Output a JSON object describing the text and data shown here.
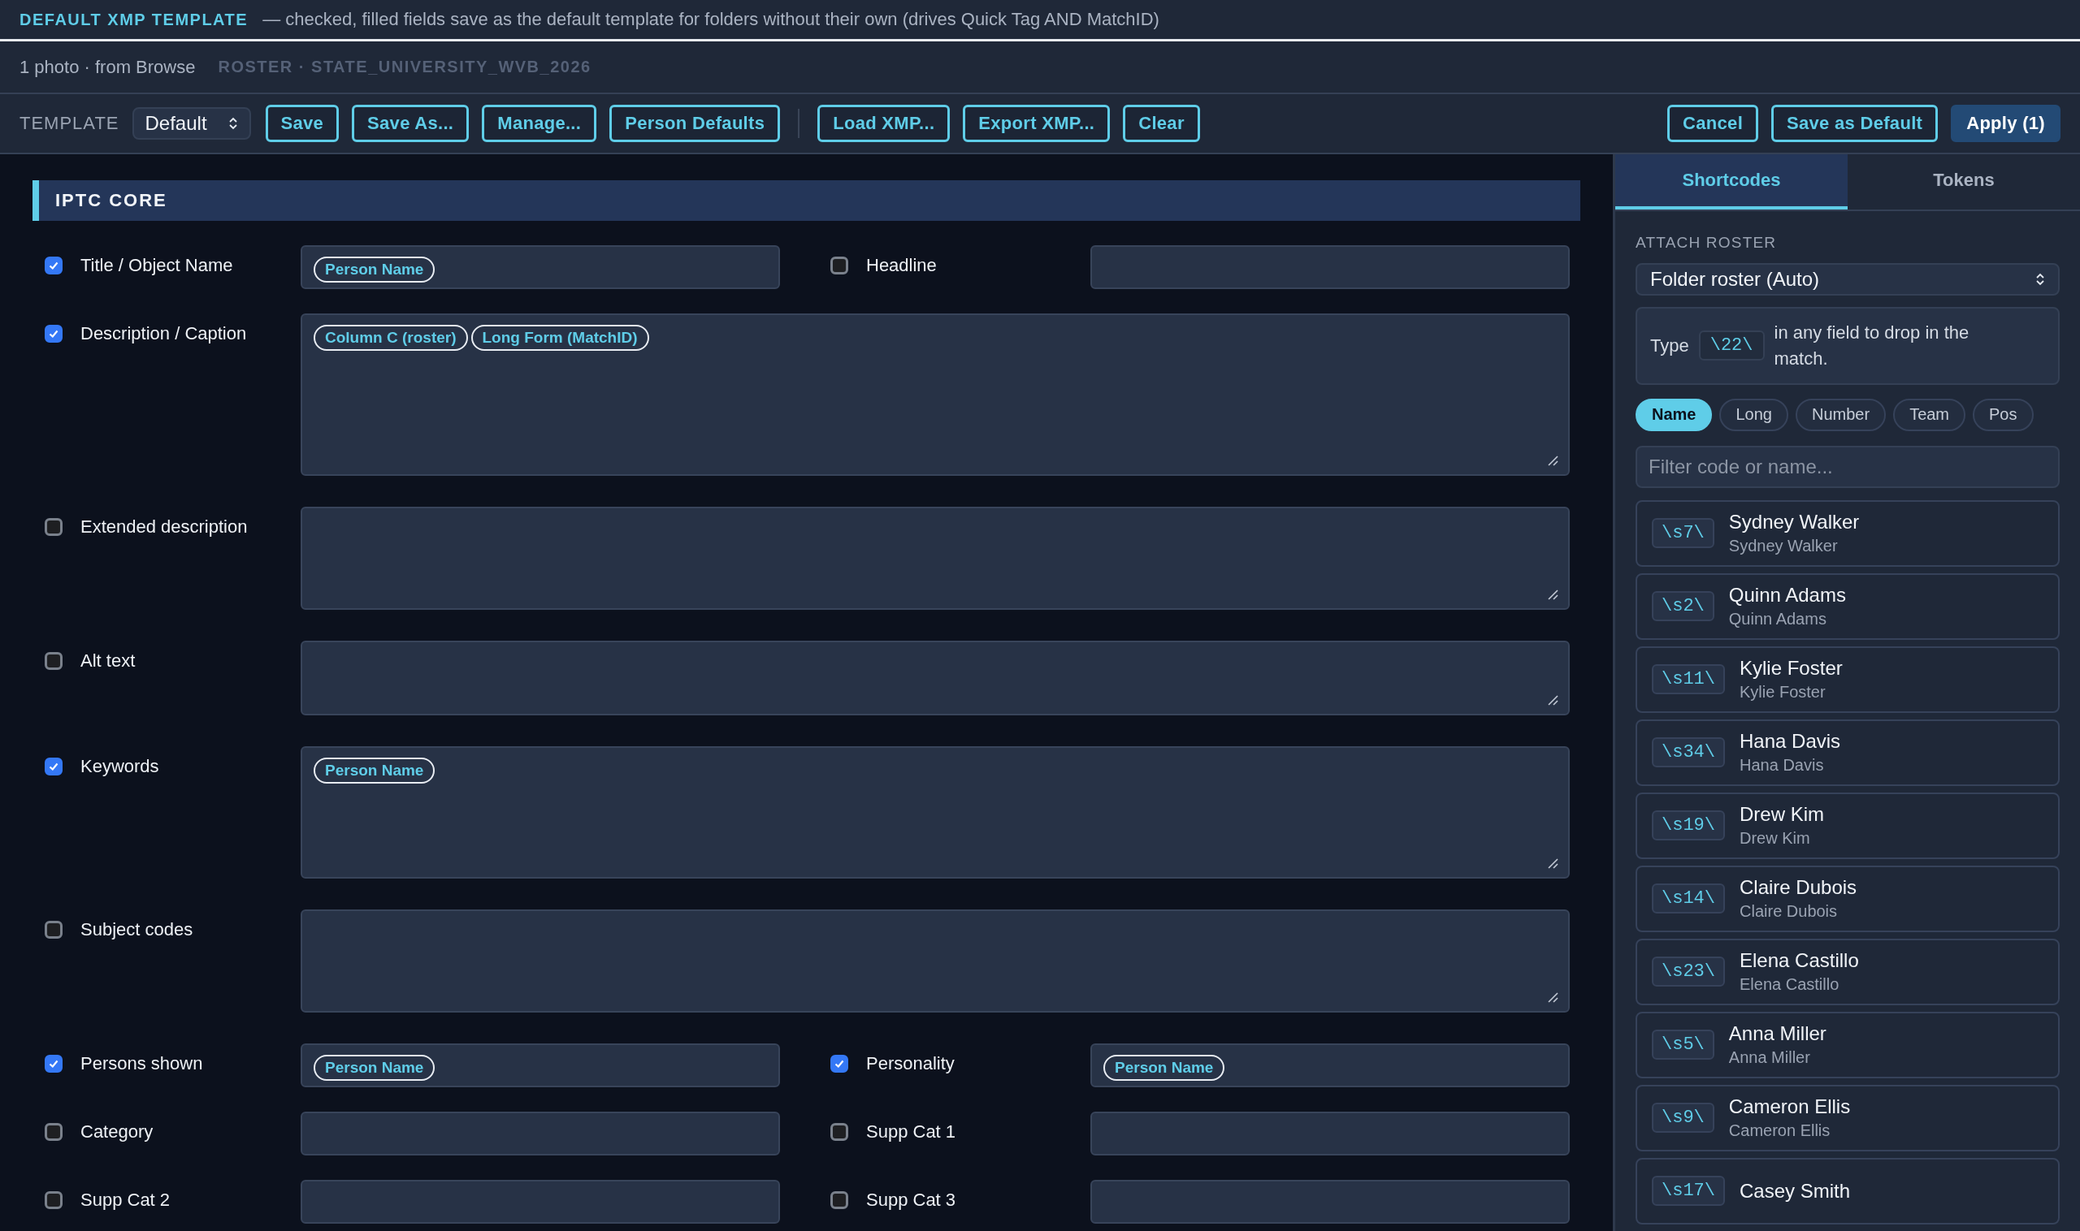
{
  "header": {
    "title": "DEFAULT XMP TEMPLATE",
    "description": "— checked, filled fields save as the default template for folders without their own (drives Quick Tag AND MatchID)"
  },
  "subheader": {
    "source": "1 photo · from Browse",
    "roster": "ROSTER · STATE_UNIVERSITY_WVB_2026"
  },
  "toolbar": {
    "template_label": "TEMPLATE",
    "template_value": "Default",
    "left_groups": [
      [
        {
          "label": "Save",
          "kind": "outline"
        },
        {
          "label": "Save As...",
          "kind": "outline"
        },
        {
          "label": "Manage...",
          "kind": "outline"
        },
        {
          "label": "Person Defaults",
          "kind": "outline"
        }
      ],
      [
        {
          "label": "Load XMP...",
          "kind": "outline"
        },
        {
          "label": "Export XMP...",
          "kind": "outline"
        },
        {
          "label": "Clear",
          "kind": "outline"
        }
      ]
    ],
    "right_buttons": [
      {
        "label": "Cancel",
        "kind": "outline"
      },
      {
        "label": "Save as Default",
        "kind": "outline"
      },
      {
        "label": "Apply (1)",
        "kind": "primary"
      }
    ]
  },
  "section": {
    "title": "IPTC CORE",
    "rows": [
      {
        "kind": "pair",
        "fields": [
          {
            "label": "Title / Object Name",
            "checked": true,
            "tokens": [
              "Person Name"
            ]
          },
          {
            "label": "Headline",
            "checked": false
          }
        ]
      },
      {
        "kind": "area",
        "fields": [
          {
            "label": "Description / Caption",
            "checked": true,
            "tokens": [
              "Column C (roster)",
              "Long Form (MatchID)"
            ]
          }
        ]
      },
      {
        "kind": "area",
        "fields": [
          {
            "label": "Extended description",
            "checked": false
          }
        ]
      },
      {
        "kind": "area",
        "fields": [
          {
            "label": "Alt text",
            "checked": false
          }
        ]
      },
      {
        "kind": "area",
        "fields": [
          {
            "label": "Keywords",
            "checked": true,
            "tokens": [
              "Person Name"
            ]
          }
        ]
      },
      {
        "kind": "area",
        "fields": [
          {
            "label": "Subject codes",
            "checked": false
          }
        ]
      },
      {
        "kind": "pair",
        "fields": [
          {
            "label": "Persons shown",
            "checked": true,
            "tokens": [
              "Person Name"
            ]
          },
          {
            "label": "Personality",
            "checked": true,
            "tokens": [
              "Person Name"
            ]
          }
        ]
      },
      {
        "kind": "pair",
        "fields": [
          {
            "label": "Category",
            "checked": false
          },
          {
            "label": "Supp Cat 1",
            "checked": false
          }
        ]
      },
      {
        "kind": "pair",
        "fields": [
          {
            "label": "Supp Cat 2",
            "checked": false
          },
          {
            "label": "Supp Cat 3",
            "checked": false
          }
        ]
      }
    ]
  },
  "panel": {
    "tabs": [
      {
        "label": "Shortcodes",
        "selected": true
      },
      {
        "label": "Tokens",
        "selected": false
      }
    ],
    "roster_label": "ATTACH ROSTER",
    "roster_value": "Folder roster (Auto)",
    "hint": {
      "before": "Type",
      "code": "\\22\\",
      "after": "in any field to drop in the match."
    },
    "chips": [
      {
        "label": "Name",
        "selected": true
      },
      {
        "label": "Long",
        "selected": false
      },
      {
        "label": "Number",
        "selected": false
      },
      {
        "label": "Team",
        "selected": false
      },
      {
        "label": "Pos",
        "selected": false
      }
    ],
    "filter_placeholder": "Filter code or name...",
    "entries": [
      {
        "code": "\\s7\\",
        "name": "Sydney Walker",
        "sub": "Sydney Walker"
      },
      {
        "code": "\\s2\\",
        "name": "Quinn Adams",
        "sub": "Quinn Adams"
      },
      {
        "code": "\\s11\\",
        "name": "Kylie Foster",
        "sub": "Kylie Foster"
      },
      {
        "code": "\\s34\\",
        "name": "Hana Davis",
        "sub": "Hana Davis"
      },
      {
        "code": "\\s19\\",
        "name": "Drew Kim",
        "sub": "Drew Kim"
      },
      {
        "code": "\\s14\\",
        "name": "Claire Dubois",
        "sub": "Claire Dubois"
      },
      {
        "code": "\\s23\\",
        "name": "Elena Castillo",
        "sub": "Elena Castillo"
      },
      {
        "code": "\\s5\\",
        "name": "Anna Miller",
        "sub": "Anna Miller"
      },
      {
        "code": "\\s9\\",
        "name": "Cameron Ellis",
        "sub": "Cameron Ellis"
      },
      {
        "code": "\\s17\\",
        "name": "Casey Smith"
      }
    ]
  }
}
